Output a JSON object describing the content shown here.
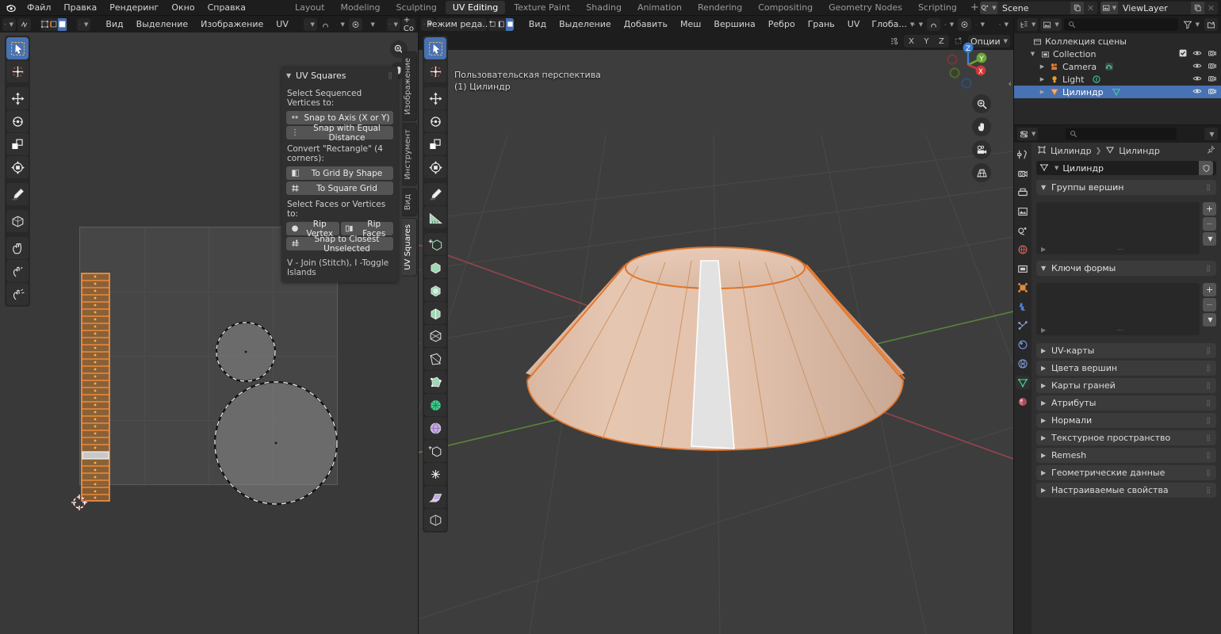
{
  "topbar": {
    "logo": "blender-logo",
    "menus": [
      "Файл",
      "Правка",
      "Рендеринг",
      "Окно",
      "Справка"
    ],
    "workspaces": [
      {
        "label": "Layout",
        "active": false
      },
      {
        "label": "Modeling",
        "active": false
      },
      {
        "label": "Sculpting",
        "active": false
      },
      {
        "label": "UV Editing",
        "active": true
      },
      {
        "label": "Texture Paint",
        "active": false
      },
      {
        "label": "Shading",
        "active": false
      },
      {
        "label": "Animation",
        "active": false
      },
      {
        "label": "Rendering",
        "active": false
      },
      {
        "label": "Compositing",
        "active": false
      },
      {
        "label": "Geometry Nodes",
        "active": false
      },
      {
        "label": "Scripting",
        "active": false
      }
    ],
    "add_workspace": "+",
    "scene_name": "Scene",
    "viewlayer_name": "ViewLayer"
  },
  "uv_editor": {
    "editor_type": "uv-editor-icon",
    "select_modes": [
      "vertex",
      "edge",
      "face",
      "island"
    ],
    "menus": [
      "Вид",
      "Выделение",
      "Изображение",
      "UV"
    ],
    "new_image_label": "+ Со",
    "side_tabs": [
      {
        "label": "Изображение",
        "active": false
      },
      {
        "label": "Инструмент",
        "active": false
      },
      {
        "label": "Вид",
        "active": false
      },
      {
        "label": "UV Squares",
        "active": true
      }
    ],
    "tools": [
      {
        "name": "tweak-tool",
        "active": true
      },
      {
        "name": "cursor-tool",
        "active": false
      },
      {
        "name": "move-tool",
        "active": false
      },
      {
        "name": "rotate-tool",
        "active": false
      },
      {
        "name": "scale-tool",
        "active": false
      },
      {
        "name": "transform-tool",
        "active": false
      },
      {
        "name": "annotate-tool",
        "active": false
      },
      {
        "name": "rip-region-tool",
        "active": false
      },
      {
        "name": "grab-tool",
        "active": false
      },
      {
        "name": "relax-tool",
        "active": false
      },
      {
        "name": "pinch-tool",
        "active": false
      }
    ]
  },
  "uv_squares": {
    "title": "UV Squares",
    "section1_label": "Select Sequenced Vertices to:",
    "btn_snap_axis": "Snap to Axis (X or Y)",
    "btn_snap_equal": "Snap with Equal Distance",
    "section2_label": "Convert \"Rectangle\" (4 corners):",
    "btn_grid_shape": "To Grid By Shape",
    "btn_square_grid": "To Square Grid",
    "section3_label": "Select Faces or Vertices to:",
    "btn_rip_vertex": "Rip Vertex",
    "btn_rip_faces": "Rip Faces",
    "btn_snap_closest": "Snap to Closest Unselected",
    "hint": "V - Join (Stitch), I -Toggle Islands"
  },
  "viewport": {
    "mode": "Режим реда...",
    "mesh_select_modes": [
      "vertex",
      "edge",
      "face"
    ],
    "menus": [
      "Вид",
      "Выделение",
      "Добавить",
      "Меш",
      "Вершина",
      "Ребро",
      "Грань",
      "UV"
    ],
    "transform_orientation": "Глоба...",
    "options_label": "Опции",
    "axis_locks": [
      "X",
      "Y",
      "Z"
    ],
    "view_name": "Пользовательская перспектива",
    "object_name": "(1) Цилиндр",
    "gizmo_axes": [
      "Z",
      "Y",
      "X"
    ],
    "tools": [
      {
        "name": "tweak-tool",
        "active": true
      },
      {
        "name": "cursor-tool",
        "active": false
      },
      {
        "name": "move-tool",
        "active": false
      },
      {
        "name": "rotate-tool",
        "active": false
      },
      {
        "name": "scale-tool",
        "active": false
      },
      {
        "name": "transform-tool",
        "active": false
      },
      {
        "name": "annotate-tool",
        "active": false
      },
      {
        "name": "measure-tool",
        "active": false
      },
      {
        "name": "add-cube-tool",
        "active": false
      },
      {
        "name": "extrude-region-tool",
        "active": false
      },
      {
        "name": "inset-faces-tool",
        "active": false
      },
      {
        "name": "bevel-tool",
        "active": false
      },
      {
        "name": "loop-cut-tool",
        "active": false
      },
      {
        "name": "knife-tool",
        "active": false
      },
      {
        "name": "poly-build-tool",
        "active": false
      },
      {
        "name": "spin-tool",
        "active": false
      },
      {
        "name": "smooth-tool",
        "active": false
      },
      {
        "name": "edge-slide-tool",
        "active": false
      },
      {
        "name": "shrink-fatten-tool",
        "active": false
      },
      {
        "name": "shear-tool",
        "active": false
      },
      {
        "name": "rip-region-tool",
        "active": false
      }
    ]
  },
  "outliner": {
    "display_mode": "view-layer-icon",
    "filter_icon": "filter-icon",
    "new_collection_icon": "new-collection-icon",
    "search_placeholder": "",
    "rows": [
      {
        "label": "Коллекция сцены",
        "indent": 0,
        "icon": "scene-collection-icon",
        "has_tri": false,
        "selected": false,
        "show_checkbox": false,
        "show_eye": false,
        "show_camera": false
      },
      {
        "label": "Collection",
        "indent": 1,
        "icon": "collection-icon",
        "has_tri": true,
        "selected": false,
        "show_checkbox": true,
        "show_eye": true,
        "show_camera": true
      },
      {
        "label": "Camera",
        "indent": 2,
        "icon": "camera-icon",
        "has_tri": true,
        "selected": false,
        "show_checkbox": false,
        "show_eye": true,
        "show_camera": true,
        "data_icon": "camera-data-icon"
      },
      {
        "label": "Light",
        "indent": 2,
        "icon": "light-icon",
        "has_tri": true,
        "selected": false,
        "show_checkbox": false,
        "show_eye": true,
        "show_camera": true,
        "data_icon": "light-data-icon"
      },
      {
        "label": "Цилиндр",
        "indent": 2,
        "icon": "mesh-object-icon",
        "has_tri": true,
        "selected": true,
        "show_checkbox": false,
        "show_eye": true,
        "show_camera": true,
        "data_icon": "mesh-data-icon"
      }
    ]
  },
  "properties": {
    "editor_icon": "properties-editor-icon",
    "search_placeholder": "",
    "breadcrumb_object": "Цилиндр",
    "breadcrumb_data": "Цилиндр",
    "datablock_name": "Цилиндр",
    "tabs": [
      {
        "name": "tool-tab",
        "active": false,
        "color": "#cfcfcf"
      },
      {
        "name": "render-tab",
        "active": false,
        "color": "#cfcfcf"
      },
      {
        "name": "output-tab",
        "active": false,
        "color": "#cfcfcf"
      },
      {
        "name": "view-layer-tab",
        "active": false,
        "color": "#cfcfcf"
      },
      {
        "name": "scene-tab",
        "active": false,
        "color": "#cfcfcf"
      },
      {
        "name": "world-tab",
        "active": false,
        "color": "#c05c5c"
      },
      {
        "name": "collection-tab",
        "active": false,
        "color": "#cfcfcf"
      },
      {
        "name": "object-tab",
        "active": false,
        "color": "#e08a3c"
      },
      {
        "name": "modifier-tab",
        "active": false,
        "color": "#4f7fd0"
      },
      {
        "name": "particles-tab",
        "active": false,
        "color": "#8aa8d8"
      },
      {
        "name": "physics-tab",
        "active": false,
        "color": "#6f8fd8"
      },
      {
        "name": "constraints-tab",
        "active": false,
        "color": "#7a9ad8"
      },
      {
        "name": "data-tab",
        "active": true,
        "color": "#3fcf8e"
      },
      {
        "name": "material-tab",
        "active": false,
        "color": "#d06a7a"
      }
    ],
    "panels": [
      {
        "label": "Группы вершин",
        "expanded": true,
        "type": "list"
      },
      {
        "label": "Ключи формы",
        "expanded": true,
        "type": "list"
      },
      {
        "label": "UV-карты",
        "expanded": false,
        "type": "collapsed"
      },
      {
        "label": "Цвета вершин",
        "expanded": false,
        "type": "collapsed"
      },
      {
        "label": "Карты граней",
        "expanded": false,
        "type": "collapsed"
      },
      {
        "label": "Атрибуты",
        "expanded": false,
        "type": "collapsed"
      },
      {
        "label": "Нормали",
        "expanded": false,
        "type": "collapsed"
      },
      {
        "label": "Текстурное пространство",
        "expanded": false,
        "type": "collapsed"
      },
      {
        "label": "Remesh",
        "expanded": false,
        "type": "collapsed"
      },
      {
        "label": "Геометрические данные",
        "expanded": false,
        "type": "collapsed"
      },
      {
        "label": "Настраиваемые свойства",
        "expanded": false,
        "type": "collapsed"
      }
    ]
  },
  "colors": {
    "accent_blue": "#4772b3",
    "selection_orange": "#ed7b32",
    "mesh_face": "#e0c4ae",
    "active_white": "#e8e8e8",
    "bg_dark": "#1d1d1d",
    "bg_mid": "#303030",
    "bg_canvas": "#393939"
  }
}
